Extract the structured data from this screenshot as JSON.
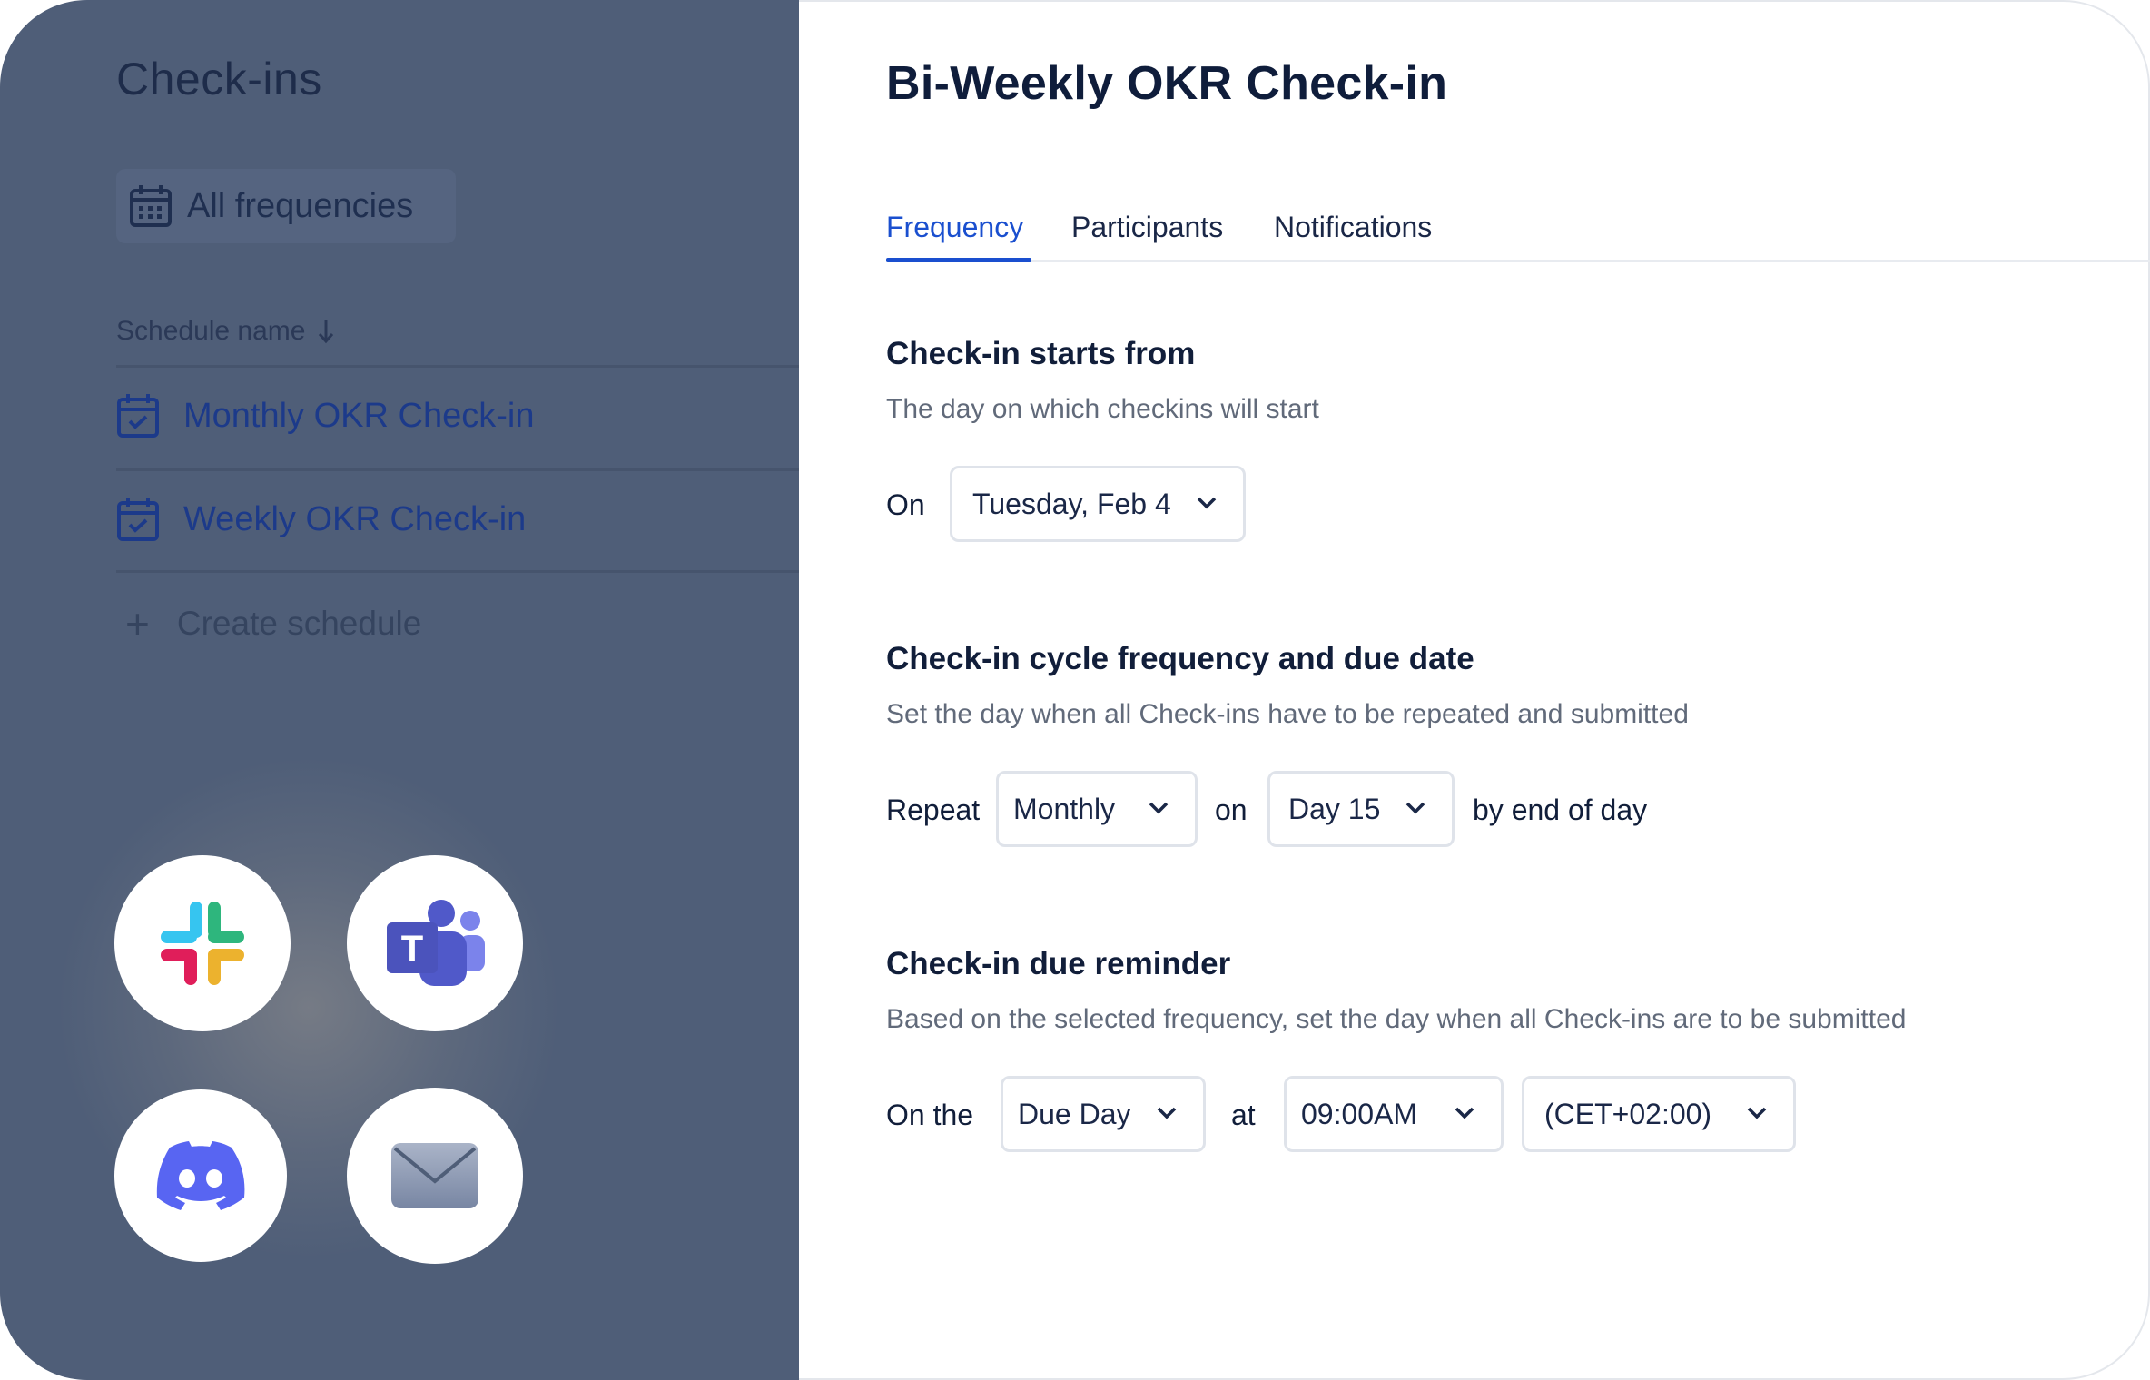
{
  "sidebar": {
    "title": "Check-ins",
    "filter_label": "All frequencies",
    "column_header": "Schedule name",
    "items": [
      {
        "label": "Monthly OKR Check-in"
      },
      {
        "label": "Weekly OKR Check-in"
      }
    ],
    "create_label": "Create schedule",
    "integrations": [
      "slack-icon",
      "microsoft-teams-icon",
      "discord-icon",
      "email-icon"
    ]
  },
  "main": {
    "title": "Bi-Weekly OKR Check-in",
    "tabs": [
      {
        "label": "Frequency",
        "active": true
      },
      {
        "label": "Participants",
        "active": false
      },
      {
        "label": "Notifications",
        "active": false
      }
    ],
    "start": {
      "title": "Check-in starts from",
      "subtitle": "The day on which checkins will start",
      "on_label": "On",
      "date_value": "Tuesday, Feb 4"
    },
    "cycle": {
      "title": "Check-in cycle frequency and due date",
      "subtitle": "Set the day when all Check-ins have to be repeated and submitted",
      "repeat_label": "Repeat",
      "repeat_value": "Monthly",
      "on_label": "on",
      "day_value": "Day 15",
      "suffix": "by end of day"
    },
    "reminder": {
      "title": "Check-in due reminder",
      "subtitle": "Based on the selected frequency, set the day when all Check-ins are to be submitted",
      "on_the_label": "On the",
      "day_value": "Due Day",
      "at_label": "at",
      "time_value": "09:00AM",
      "timezone_value": "(CET+02:00)"
    }
  },
  "colors": {
    "sidebar_bg": "#4f5e78",
    "accent": "#1a4fcf",
    "text_dark": "#111e3a"
  }
}
